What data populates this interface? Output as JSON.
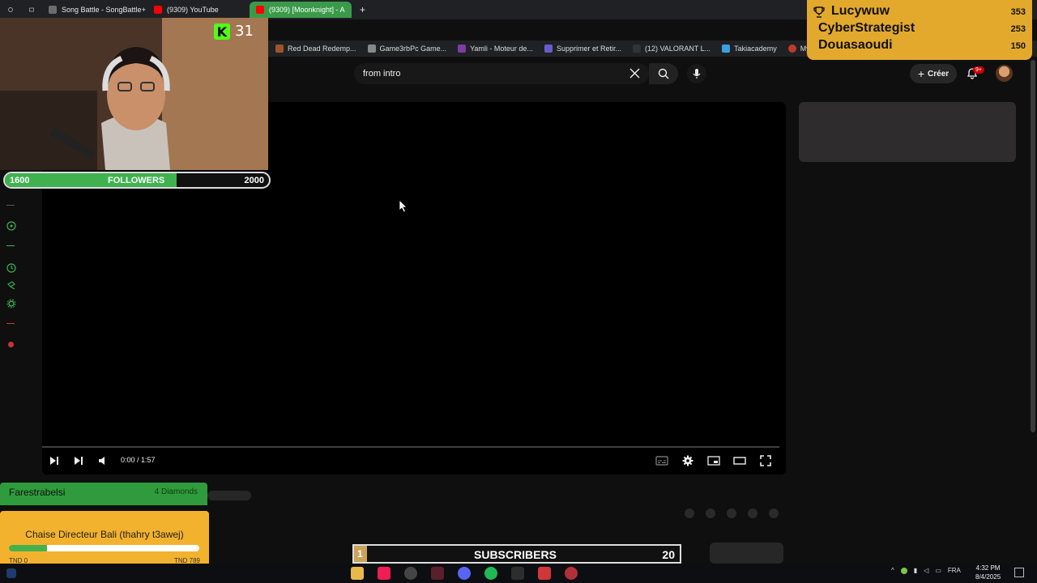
{
  "browser": {
    "tabs": [
      {
        "label": "Song Battle - SongBattle+",
        "color": "#6c6c6c"
      },
      {
        "label": "(9309) YouTube",
        "color": "#ff0000"
      },
      {
        "label": "(9309) [Moonknight] - A",
        "color": "#ff0000",
        "active": true
      }
    ],
    "bookmarks": [
      {
        "label": "Red Dead Redemp...",
        "color": "#a0522d"
      },
      {
        "label": "Game3rbPc Game...",
        "color": "#888888"
      },
      {
        "label": "Yamli - Moteur de...",
        "color": "#7b3fa0"
      },
      {
        "label": "Supprimer et Retir...",
        "color": "#6a5acd"
      },
      {
        "label": "(12) VALORANT L...",
        "color": "#ffffff"
      },
      {
        "label": "Takiacademy",
        "color": "#3aa0e0"
      },
      {
        "label": "Myinstants | ",
        "color": "#c0392b"
      }
    ]
  },
  "youtube": {
    "search_value": "from intro",
    "create_label": "Créer",
    "notif_count": "9+",
    "time_display": "0:00 / 1:57"
  },
  "overlay": {
    "kick_count": "31",
    "followers": {
      "label": "FOLLOWERS",
      "current": "1600",
      "goal": "2000",
      "progress": 0.65
    },
    "leaderboard": [
      {
        "name": "Lucywuw",
        "score": "353"
      },
      {
        "name": "CyberStrategist",
        "score": "253"
      },
      {
        "name": "Douasaoudi",
        "score": "150"
      }
    ],
    "top_donor": {
      "name": "Farestrabelsi",
      "amount": "4 Diamonds"
    },
    "goal": {
      "title": "Chaise Directeur Bali (thahry t3awej)",
      "min": "TND 0",
      "max": "TND 789",
      "progress": 0.2
    },
    "subscribers": {
      "current": "1",
      "label": "SUBSCRIBERS",
      "goal": "20"
    }
  },
  "taskbar": {
    "lang": "FRA",
    "time": "4:32 PM",
    "date": "8/4/2025"
  },
  "colors": {
    "accent_green": "#3fb24f",
    "overlay_gold": "#e3a92d",
    "youtube_red": "#ff0000"
  }
}
